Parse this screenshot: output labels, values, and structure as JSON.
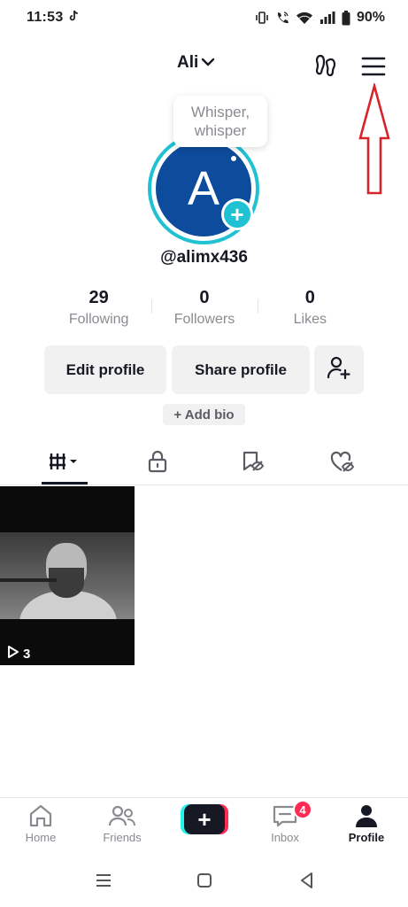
{
  "status_bar": {
    "time": "11:53",
    "battery": "90%",
    "icons": [
      "tiktok-notification-icon",
      "vibrate-icon",
      "wifi-call-icon",
      "wifi-icon",
      "signal-icon",
      "battery-icon"
    ]
  },
  "header": {
    "username": "Ali",
    "icons": [
      "chevron-down-icon",
      "footprints-icon",
      "hamburger-menu-icon"
    ]
  },
  "annotation": {
    "type": "red-outline-arrow-up",
    "color": "#d8232a"
  },
  "profile": {
    "avatar_initial": "A",
    "avatar_color": "#0d4b9c",
    "ring_color": "#20c1d3",
    "whisper_line1": "Whisper,",
    "whisper_line2": "whisper",
    "handle": "@alimx436"
  },
  "stats": [
    {
      "value": "29",
      "label": "Following"
    },
    {
      "value": "0",
      "label": "Followers"
    },
    {
      "value": "0",
      "label": "Likes"
    }
  ],
  "actions": {
    "edit_profile": "Edit profile",
    "share_profile": "Share profile",
    "add_friend_icon": "add-user-icon",
    "add_bio": "+ Add bio"
  },
  "tabs": [
    {
      "icon": "videos-grid-icon",
      "active": true
    },
    {
      "icon": "lock-icon",
      "active": false
    },
    {
      "icon": "favorites-hidden-icon",
      "active": false
    },
    {
      "icon": "liked-hidden-icon",
      "active": false
    }
  ],
  "videos": [
    {
      "views": "3"
    }
  ],
  "bottom_nav": {
    "home": "Home",
    "friends": "Friends",
    "create_icon": "plus-icon",
    "inbox": "Inbox",
    "inbox_badge": "4",
    "profile": "Profile"
  },
  "system_nav": [
    "recents-icon",
    "home-icon",
    "back-icon"
  ],
  "colors": {
    "accent_red": "#fe2c55",
    "accent_cyan": "#25f4ee",
    "text_primary": "#161823",
    "text_secondary": "#8a8b91"
  }
}
